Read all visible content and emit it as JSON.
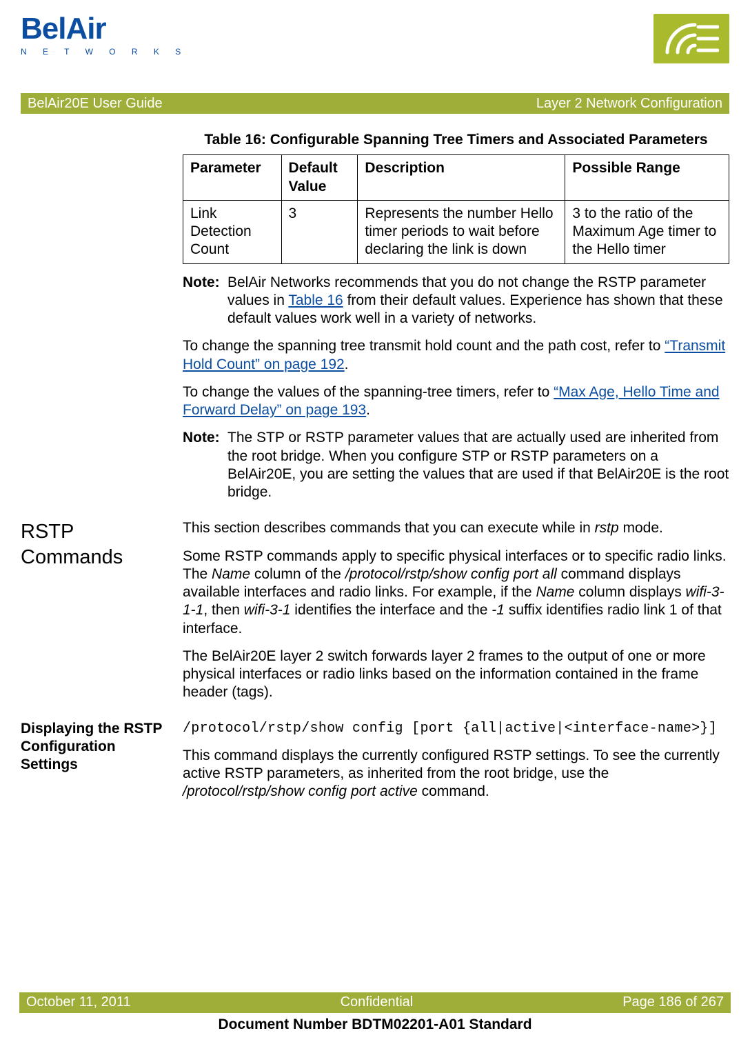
{
  "brand": {
    "name": "BelAir",
    "tagline": "N E T W O R K S"
  },
  "titlebar": {
    "left": "BelAir20E User Guide",
    "right": "Layer 2 Network Configuration"
  },
  "table": {
    "caption": "Table 16: Configurable Spanning Tree Timers and Associated Parameters",
    "headers": {
      "parameter": "Parameter",
      "default": "Default Value",
      "desc": "Description",
      "range": "Possible Range"
    },
    "rows": [
      {
        "parameter": "Link Detection Count",
        "default": "3",
        "desc": "Represents the number Hello timer periods to wait before declaring the link is down",
        "range": "3 to the ratio of the Maximum Age timer to the Hello timer"
      }
    ]
  },
  "notes": {
    "label": "Note:",
    "note1_a": "BelAir Networks recommends that you do not change the RSTP parameter values in ",
    "note1_link": "Table 16",
    "note1_b": " from their default values. Experience has shown that these default values work well in a variety of networks.",
    "note2": "The STP or RSTP parameter values that are actually used are inherited from the root bridge. When you configure STP or RSTP parameters on a BelAir20E, you are setting the values that are used if that BelAir20E is the root bridge."
  },
  "para": {
    "p1_a": "To change the spanning tree transmit hold count and the path cost, refer to ",
    "p1_link": "“Transmit Hold Count” on page 192",
    "p1_b": ".",
    "p2_a": "To change the values of the spanning-tree timers, refer to ",
    "p2_link": "“Max Age, Hello Time and Forward Delay” on page 193",
    "p2_b": "."
  },
  "rstp": {
    "heading": "RSTP Commands",
    "intro_a": "This section describes commands that you can execute while in ",
    "intro_mode": "rstp",
    "intro_b": " mode.",
    "p2": {
      "a": "Some RSTP commands apply to specific physical interfaces or to specific radio links. The ",
      "name1": "Name",
      "b": " column of the ",
      "cmd1": "/protocol/rstp/show config port all",
      "c": " command displays available interfaces and radio links. For example, if the ",
      "name2": "Name",
      "d": " column displays ",
      "ex1": "wifi-3-1-1",
      "e": ", then ",
      "ex2": "wifi-3-1",
      "f": " identifies the interface and the ",
      "ex3": "-1",
      "g": " suffix identifies radio link 1 of that interface."
    },
    "p3": "The BelAir20E layer 2 switch forwards layer 2 frames to the output of one or more physical interfaces or radio links based on the information contained in the frame header (tags)."
  },
  "display": {
    "heading": "Displaying the RSTP Configuration Settings",
    "cmd": "/protocol/rstp/show config [port {all|active|<interface-name>}]",
    "para_a": "This command displays the currently configured RSTP settings. To see the currently active RSTP parameters, as inherited from the root bridge, use the ",
    "para_cmd": "/protocol/rstp/show config port active",
    "para_b": " command."
  },
  "footer": {
    "left": "October 11, 2011",
    "mid": "Confidential",
    "right": "Page 186 of 267",
    "sub": "Document Number BDTM02201-A01 Standard"
  }
}
